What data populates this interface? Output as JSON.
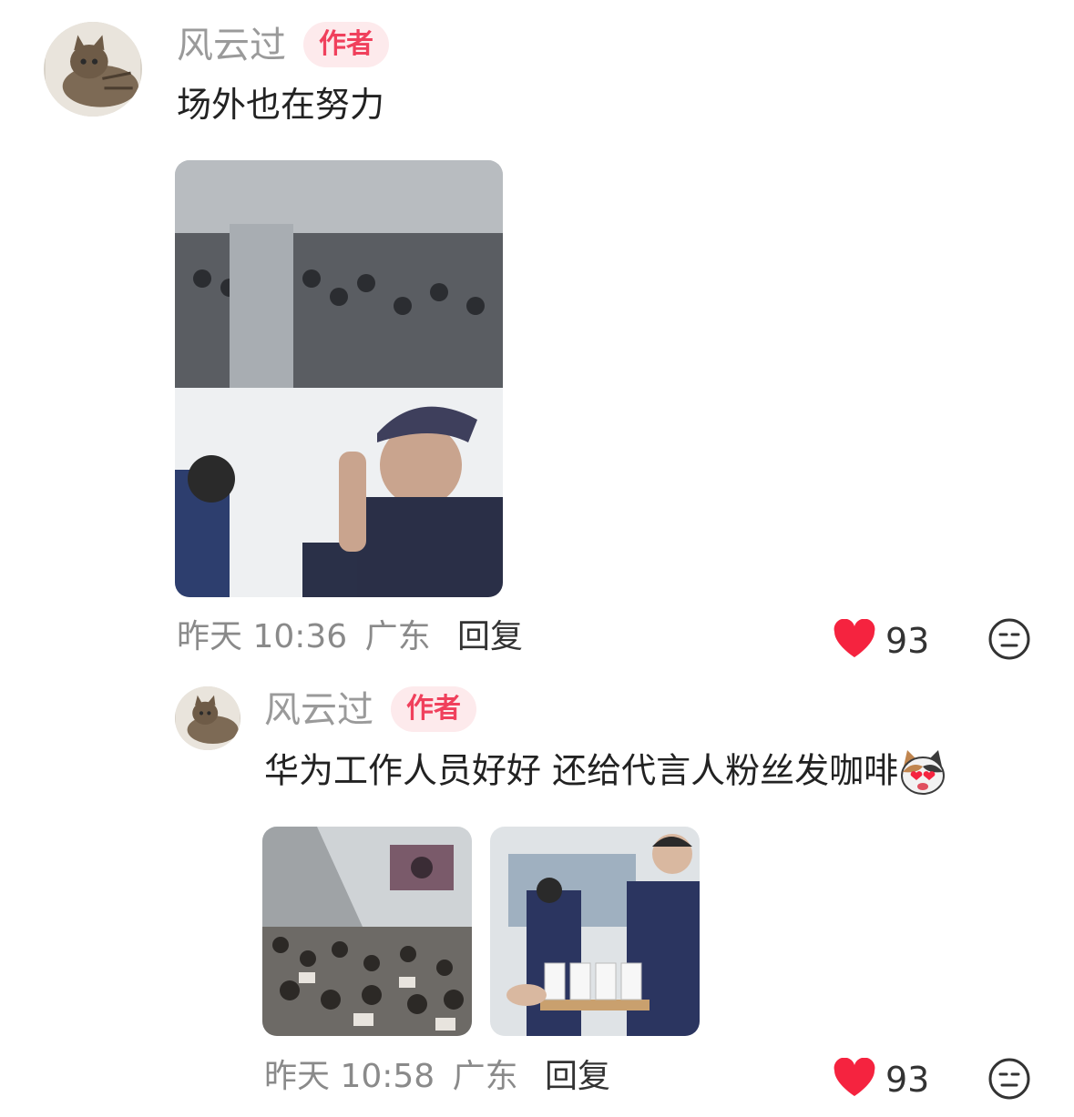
{
  "comment": {
    "author": "风云过",
    "badge": "作者",
    "text": "场外也在努力",
    "time": "昨天 10:36",
    "location": "广东",
    "reply_label": "回复",
    "likes": "93",
    "images": [
      "security-guard-photo"
    ]
  },
  "reply": {
    "author": "风云过",
    "badge": "作者",
    "text": "华为工作人员好好 还给代言人粉丝发咖啡",
    "emoji_icon": "heart-eyes-cat-emoji",
    "time": "昨天 10:58",
    "location": "广东",
    "reply_label": "回复",
    "likes": "93",
    "images": [
      "crowd-photo",
      "coffee-tray-photo"
    ]
  },
  "colors": {
    "like": "#f5233f",
    "badge_bg": "#fdeaec",
    "badge_text": "#f0405c"
  }
}
